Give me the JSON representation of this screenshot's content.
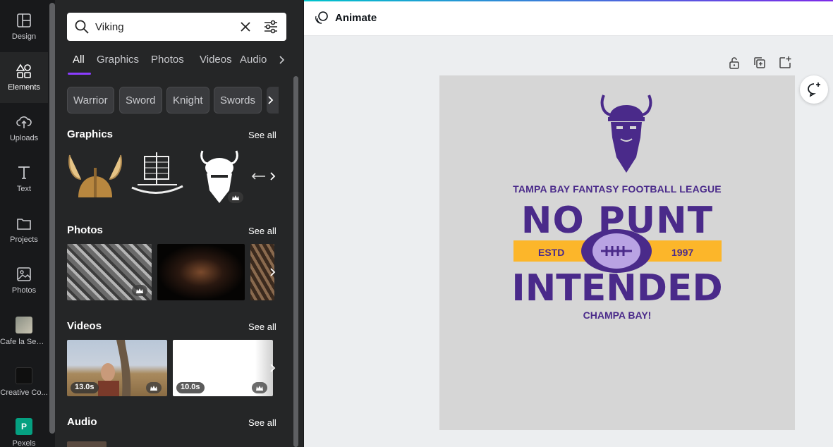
{
  "rail": {
    "items": [
      {
        "label": "Design",
        "icon": "layout-icon"
      },
      {
        "label": "Elements",
        "icon": "shapes-icon"
      },
      {
        "label": "Uploads",
        "icon": "cloud-upload-icon"
      },
      {
        "label": "Text",
        "icon": "text-icon"
      },
      {
        "label": "Projects",
        "icon": "folder-icon"
      },
      {
        "label": "Photos",
        "icon": "image-icon"
      },
      {
        "label": "Cafe la Sem...",
        "icon": "app-thumbnail"
      },
      {
        "label": "Creative Co...",
        "icon": "app-thumbnail"
      },
      {
        "label": "Pexels",
        "icon": "pexels-logo"
      }
    ]
  },
  "search": {
    "value": "Viking",
    "placeholder": "Search elements"
  },
  "tabs": [
    "All",
    "Graphics",
    "Photos",
    "Videos",
    "Audio"
  ],
  "chips": [
    "Warrior",
    "Sword",
    "Knight",
    "Swords"
  ],
  "sections": {
    "graphics": {
      "title": "Graphics",
      "see_all": "See all"
    },
    "photos": {
      "title": "Photos",
      "see_all": "See all"
    },
    "videos": {
      "title": "Videos",
      "see_all": "See all",
      "durations": [
        "13.0s",
        "10.0s"
      ]
    },
    "audio": {
      "title": "Audio",
      "see_all": "See all"
    }
  },
  "topbar": {
    "animate_label": "Animate"
  },
  "design": {
    "league": "TAMPA BAY FANTASY FOOTBALL LEAGUE",
    "line1": "NO PUNT",
    "line2": "INTENDED",
    "estd": "ESTD",
    "year": "1997",
    "tagline": "CHAMPA BAY!"
  },
  "colors": {
    "accent": "#8b3dff",
    "design_purple": "#4a2a8a",
    "design_gold": "#fcb62a",
    "page_bg": "#d6d6d6"
  }
}
